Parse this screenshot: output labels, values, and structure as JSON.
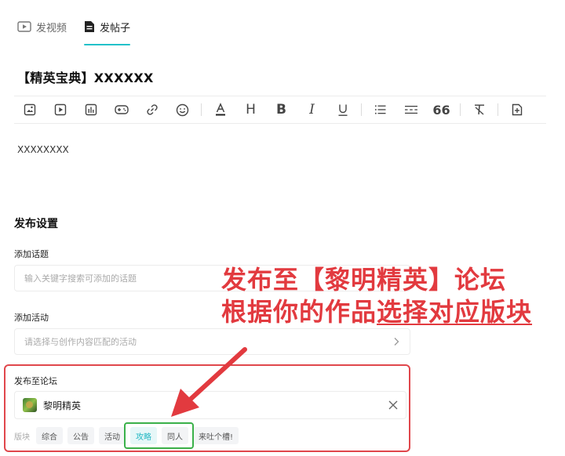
{
  "tabs": [
    {
      "label": "发视频",
      "icon": "video-icon",
      "active": false
    },
    {
      "label": "发帖子",
      "icon": "document-icon",
      "active": true
    }
  ],
  "editor": {
    "title": "【精英宝典】XXXXXX",
    "body": "XXXXXXXX",
    "toolbar": [
      "image-icon",
      "video-icon",
      "chart-icon",
      "gamepad-icon",
      "link-icon",
      "emoji-icon",
      "font-color-icon",
      "heading-icon",
      "bold-icon",
      "italic-icon",
      "underline-icon",
      "bullet-list-icon",
      "divider-icon",
      "quote-icon",
      "clear-format-icon",
      "insert-icon"
    ],
    "toolbar_glyphs": {
      "heading": "H",
      "bold": "B",
      "italic": "I",
      "underline": "U",
      "quote": "66"
    }
  },
  "settings": {
    "title": "发布设置",
    "topic": {
      "label": "添加话题",
      "placeholder": "输入关键字搜索可添加的话题"
    },
    "activity": {
      "label": "添加活动",
      "placeholder": "请选择与创作内容匹配的活动"
    },
    "forum": {
      "label": "发布至论坛",
      "selected": "黎明精英",
      "sections_label": "版块",
      "sections": [
        {
          "label": "综合",
          "selected": false
        },
        {
          "label": "公告",
          "selected": false
        },
        {
          "label": "活动",
          "selected": false
        },
        {
          "label": "攻略",
          "selected": true
        },
        {
          "label": "同人",
          "selected": false
        },
        {
          "label": "来吐个槽!",
          "selected": false
        }
      ]
    }
  },
  "annotation": {
    "line1": "发布至【黎明精英】论坛",
    "line2_prefix": "根据你的作品",
    "line2_underlined": "选择对应版块"
  },
  "colors": {
    "accent": "#22c1c9",
    "annotation_red": "#e23a3f",
    "highlight_green": "#3bb14a"
  }
}
